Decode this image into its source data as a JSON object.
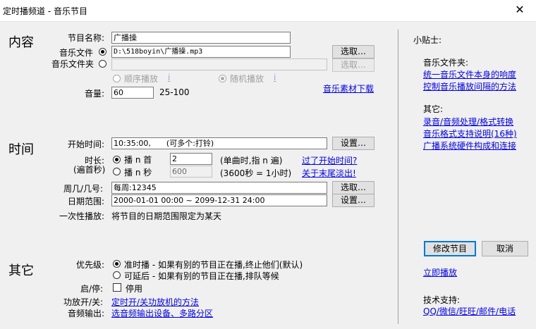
{
  "window": {
    "title": "定时播频道 - 音乐节目",
    "close_glyph": "✕"
  },
  "sections": {
    "content": "内容",
    "time": "时间",
    "other": "其它"
  },
  "content": {
    "name_label": "节目名称:",
    "name_value": "广播操",
    "music_file_label": "音乐文件",
    "music_file_value": "D:\\518boyin\\广播操.mp3",
    "music_folder_label": "音乐文件夹",
    "music_folder_value": "",
    "browse": "选取…",
    "sequential_label": "顺序播放",
    "random_label": "随机播放",
    "info_glyph": "i",
    "volume_label": "音量:",
    "volume_value": "60",
    "volume_range": "25-100",
    "music_download_link": "音乐素材下载"
  },
  "time": {
    "start_label": "开始时间:",
    "start_value": "10:35:00,　　(可多个:打铃)",
    "settings_button": "设置…",
    "duration_label": "时长:",
    "duration_sub": "(遍首秒)",
    "play_n_songs_label": "播 n 首",
    "n_songs_value": "2",
    "n_songs_hint": "(单曲时,指 n 遍)",
    "play_n_seconds_label": "播 n 秒",
    "n_seconds_value": "600",
    "n_seconds_hint": "(3600秒 = 1小时)",
    "missed_start_link": "过了开始时间?",
    "fade_out_link": "关于末尾淡出!",
    "weekday_label": "周几/几号:",
    "weekday_value": "每周:12345",
    "select_button": "选取…",
    "date_range_label": "日期范围:",
    "date_range_value": "2000-01-01 00:00 ~ 2099-12-31 24:00",
    "date_settings_button": "设置…",
    "one_time_label": "一次性播放:",
    "one_time_text": "将节目的日期范围限定为某天"
  },
  "other": {
    "priority_label": "优先级:",
    "priority_on_time": "准时播 - 如果有别的节目正在播,终止他们(默认)",
    "priority_delay": "可延后 - 如果有别的节目正在播,排队等候",
    "enable_label": "启/停:",
    "disable_label": "停用",
    "amp_label": "功放开/关:",
    "amp_link": "定时开/关功放机的方法",
    "audio_out_label": "音频输出:",
    "audio_out_link": "选音频输出设备、多路分区"
  },
  "tips": {
    "title": "小贴士:",
    "folder_heading": "音乐文件夹:",
    "folder_links": [
      "统一音乐文件本身的响度",
      "控制音乐播放间隔的方法"
    ],
    "other_heading": "其它:",
    "other_links": [
      "录音/音频处理/格式转换",
      "音乐格式支持说明(16种)",
      "广播系统硬件构成和连接"
    ]
  },
  "actions": {
    "modify": "修改节目",
    "cancel": "取消",
    "play_now": "立即播放",
    "support_label": "技术支持:",
    "support_link": "QQ/微信/旺旺/邮件/电话"
  }
}
